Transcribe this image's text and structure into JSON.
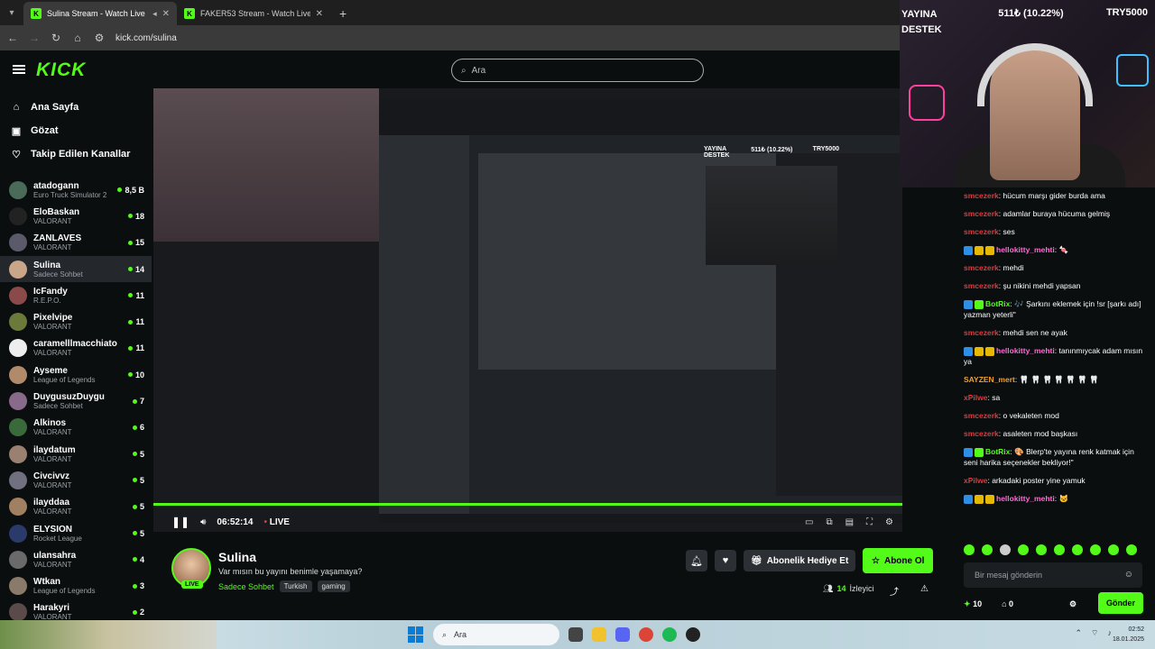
{
  "browser": {
    "tabs": [
      {
        "label": "Sulina Stream - Watch Live",
        "active": true
      },
      {
        "label": "FAKER53 Stream - Watch Live o",
        "active": false
      }
    ],
    "url": "kick.com/sulina"
  },
  "header": {
    "logo": "KICK",
    "search_placeholder": "Ara"
  },
  "sidebar": {
    "nav": [
      {
        "label": "Ana Sayfa",
        "icon": "home-icon"
      },
      {
        "label": "Gözat",
        "icon": "browse-icon"
      },
      {
        "label": "Takip Edilen Kanallar",
        "icon": "heart-icon"
      }
    ],
    "channels": [
      {
        "name": "atadogann",
        "category": "Euro Truck Simulator 2",
        "viewers": "8,5 B",
        "color": "#4a6a5a"
      },
      {
        "name": "EloBaskan",
        "category": "VALORANT",
        "viewers": "18",
        "color": "#222222"
      },
      {
        "name": "ZANLAVES",
        "category": "VALORANT",
        "viewers": "15",
        "color": "#5a5a6a"
      },
      {
        "name": "Sulina",
        "category": "Sadece Sohbet",
        "viewers": "14",
        "color": "#c9a58a"
      },
      {
        "name": "IcFandy",
        "category": "R.E.P.O.",
        "viewers": "11",
        "color": "#8a4a4a"
      },
      {
        "name": "Pixelvipe",
        "category": "VALORANT",
        "viewers": "11",
        "color": "#6a7a3a"
      },
      {
        "name": "caramelllmacchiato",
        "category": "VALORANT",
        "viewers": "11",
        "color": "#eeeeee"
      },
      {
        "name": "Ayseme",
        "category": "League of Legends",
        "viewers": "10",
        "color": "#b08a6a"
      },
      {
        "name": "DuygusuzDuygu",
        "category": "Sadece Sohbet",
        "viewers": "7",
        "color": "#8a6a8a"
      },
      {
        "name": "Alkinos",
        "category": "VALORANT",
        "viewers": "6",
        "color": "#3a6a3a"
      },
      {
        "name": "ilaydatum",
        "category": "VALORANT",
        "viewers": "5",
        "color": "#9a8070"
      },
      {
        "name": "Civcivvz",
        "category": "VALORANT",
        "viewers": "5",
        "color": "#707080"
      },
      {
        "name": "ilayddaa",
        "category": "VALORANT",
        "viewers": "5",
        "color": "#a08060"
      },
      {
        "name": "ELYSION",
        "category": "Rocket League",
        "viewers": "5",
        "color": "#2a3a6a"
      },
      {
        "name": "ulansahra",
        "category": "VALORANT",
        "viewers": "4",
        "color": "#6a6a6a"
      },
      {
        "name": "Wtkan",
        "category": "League of Legends",
        "viewers": "3",
        "color": "#8a7a6a"
      },
      {
        "name": "Harakyri",
        "category": "VALORANT",
        "viewers": "2",
        "color": "#5a4a4a"
      }
    ]
  },
  "player": {
    "time": "06:52:14",
    "live_label": "LIVE",
    "nested_overlay": {
      "left": "YAYINA DESTEK",
      "middle": "511₺ (10.22%)",
      "right": "TRY5000"
    }
  },
  "stream": {
    "name": "Sulina",
    "title": "Var mısın bu yayını benimle yaşamaya?",
    "category": "Sadece Sohbet",
    "tags": [
      "Turkish",
      "gaming"
    ],
    "gift_label": "Abonelik Hediye Et",
    "subscribe_label": "Abone Ol",
    "viewers_count": "14",
    "viewers_label": "İzleyici",
    "live_badge": "LIVE"
  },
  "webcam_overlay": {
    "left_line1": "YAYINA",
    "left_line2": "DESTEK",
    "amount": "511₺ (10.22%)",
    "goal": "TRY5000"
  },
  "chat": {
    "messages": [
      {
        "user": "smcezerk",
        "text": "hücum marşı gider burda ama",
        "color": "#e0393e",
        "badges": []
      },
      {
        "user": "smcezerk",
        "text": "adamlar buraya hücuma gelmiş",
        "color": "#e0393e",
        "badges": []
      },
      {
        "user": "smcezerk",
        "text": "ses",
        "color": "#e0393e",
        "badges": []
      },
      {
        "user": "hellokitty_mehti",
        "text": "🍬",
        "color": "#ff6ad5",
        "badges": [
          "#2f8fe6",
          "#e6b800",
          "#e6b800"
        ]
      },
      {
        "user": "smcezerk",
        "text": "mehdi",
        "color": "#e0393e",
        "badges": []
      },
      {
        "user": "smcezerk",
        "text": "şu nikini mehdi yapsan",
        "color": "#e0393e",
        "badges": []
      },
      {
        "user": "BotRix",
        "text": "🎶 Şarkını eklemek için !sr [şarkı adı] yazman yeterli\"",
        "color": "#53fc18",
        "badges": [
          "#2f8fe6",
          "#53fc18"
        ]
      },
      {
        "user": "smcezerk",
        "text": "mehdi sen ne ayak",
        "color": "#e0393e",
        "badges": []
      },
      {
        "user": "hellokitty_mehti",
        "text": "tanınmıycak adam mısın ya",
        "color": "#ff6ad5",
        "badges": [
          "#2f8fe6",
          "#e6b800",
          "#e6b800"
        ]
      },
      {
        "user": "SAYZEN_mert",
        "text": "🦷 🦷 🦷 🦷 🦷 🦷 🦷",
        "color": "#f0a030",
        "badges": []
      },
      {
        "user": "xPilwe",
        "text": "sa",
        "color": "#e0393e",
        "badges": []
      },
      {
        "user": "smcezerk",
        "text": "o vekaleten mod",
        "color": "#e0393e",
        "badges": []
      },
      {
        "user": "smcezerk",
        "text": "asaleten mod başkası",
        "color": "#e0393e",
        "badges": []
      },
      {
        "user": "BotRix",
        "text": "🎨 Blerp'te yayına renk katmak için seni harika seçenekler bekliyor!\"",
        "color": "#53fc18",
        "badges": [
          "#2f8fe6",
          "#53fc18"
        ]
      },
      {
        "user": "xPilwe",
        "text": "arkadaki poster yine yamuk",
        "color": "#e0393e",
        "badges": []
      },
      {
        "user": "hellokitty_mehti",
        "text": "🐱",
        "color": "#ff6ad5",
        "badges": [
          "#2f8fe6",
          "#e6b800",
          "#e6b800"
        ]
      }
    ],
    "input_placeholder": "Bir mesaj gönderin",
    "points": "10",
    "second_count": "0",
    "send_label": "Gönder"
  },
  "taskbar": {
    "search_placeholder": "Ara",
    "time": "02:52",
    "date": "18.01.2025"
  }
}
